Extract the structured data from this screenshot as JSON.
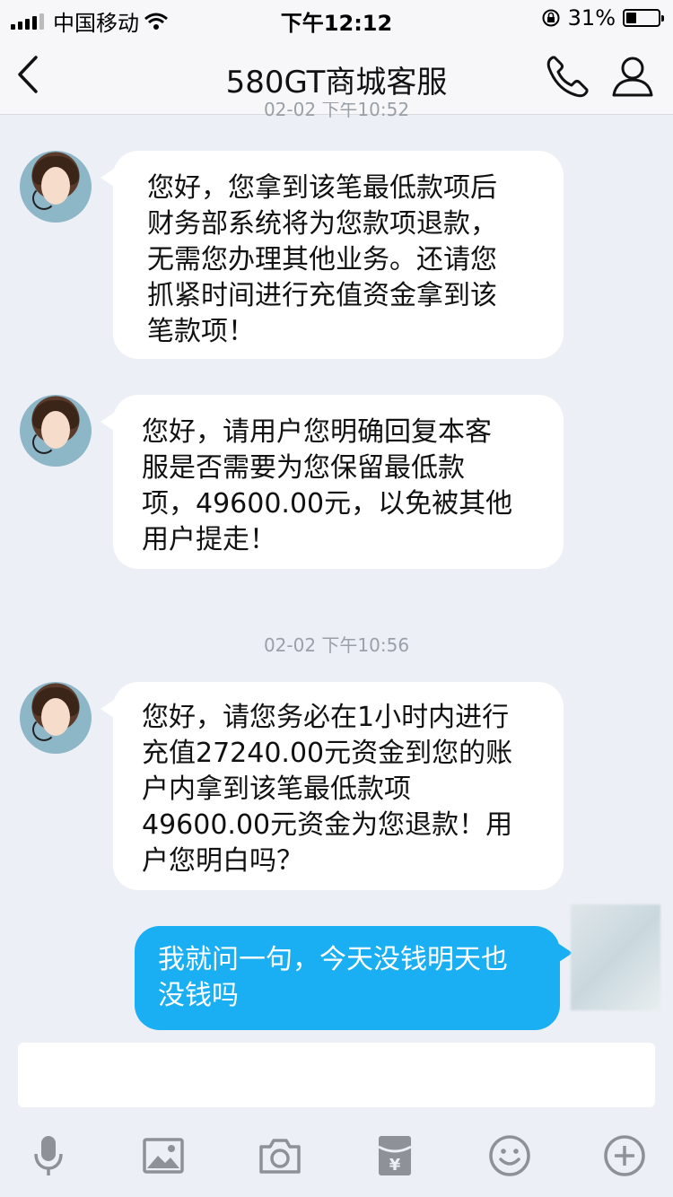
{
  "status_bar": {
    "carrier": "中国移动",
    "time": "下午12:12",
    "battery": "31%",
    "battery_level": 0.31
  },
  "nav": {
    "title": "580GT商城客服",
    "icons": [
      "back-icon",
      "phone-icon",
      "user-icon"
    ]
  },
  "timestamps": {
    "clipped": "02-02 下午10:52",
    "second": "02-02 下午10:56"
  },
  "messages": [
    {
      "sender": "agent",
      "text": "您好，您拿到该笔最低款项后\n财务部系统将为您款项退款，\n无需您办理其他业务。还请您\n抓紧时间进行充值资金拿到该\n笔款项！"
    },
    {
      "sender": "agent",
      "text": "您好，请用户您明确回复本客\n服是否需要为您保留最低款\n项，49600.00元，以免被其他\n用户提走！"
    },
    {
      "sender": "agent",
      "text": "您好，请您务必在1小时内进行\n充值27240.00元资金到您的账\n户内拿到该笔最低款项\n49600.00元资金为您退款！用\n户您明白吗？"
    },
    {
      "sender": "me",
      "text": "我就问一句，今天没钱明天也\n没钱吗"
    }
  ],
  "toolbar": {
    "icons": [
      "microphone-icon",
      "image-icon",
      "camera-icon",
      "red-packet-icon",
      "emoji-icon",
      "plus-icon"
    ]
  },
  "colors": {
    "background": "#eceff5",
    "my_bubble": "#1aaef2",
    "agent_bubble": "#ffffff",
    "icon_gray": "#8e9298"
  }
}
